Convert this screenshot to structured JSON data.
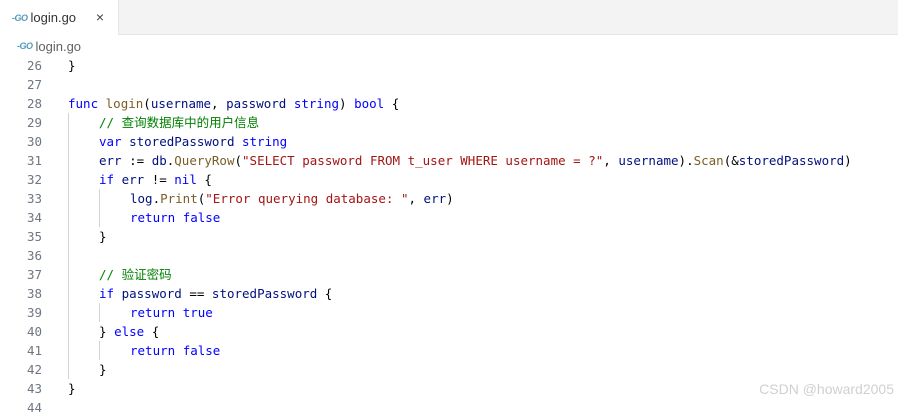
{
  "tab": {
    "filename": "login.go",
    "icon": "go-file-icon",
    "close_glyph": "×"
  },
  "breadcrumb": {
    "filename": "login.go"
  },
  "editor": {
    "lines": [
      {
        "num": "26",
        "indent": 0,
        "tokens": [
          [
            "p",
            "}"
          ]
        ]
      },
      {
        "num": "27",
        "indent": 0,
        "tokens": []
      },
      {
        "num": "28",
        "indent": 0,
        "tokens": [
          [
            "kw",
            "func"
          ],
          [
            "p",
            " "
          ],
          [
            "fn",
            "login"
          ],
          [
            "p",
            "("
          ],
          [
            "vr",
            "username"
          ],
          [
            "p",
            ", "
          ],
          [
            "vr",
            "password"
          ],
          [
            "p",
            " "
          ],
          [
            "kw",
            "string"
          ],
          [
            "p",
            ") "
          ],
          [
            "kw",
            "bool"
          ],
          [
            "p",
            " {"
          ]
        ]
      },
      {
        "num": "29",
        "indent": 1,
        "tokens": [
          [
            "cm",
            "// 查询数据库中的用户信息"
          ]
        ]
      },
      {
        "num": "30",
        "indent": 1,
        "tokens": [
          [
            "kw",
            "var"
          ],
          [
            "p",
            " "
          ],
          [
            "vr",
            "storedPassword"
          ],
          [
            "p",
            " "
          ],
          [
            "kw",
            "string"
          ]
        ]
      },
      {
        "num": "31",
        "indent": 1,
        "tokens": [
          [
            "vr",
            "err"
          ],
          [
            "p",
            " := "
          ],
          [
            "vr",
            "db"
          ],
          [
            "p",
            "."
          ],
          [
            "fn",
            "QueryRow"
          ],
          [
            "p",
            "("
          ],
          [
            "str",
            "\"SELECT password FROM t_user WHERE username = ?\""
          ],
          [
            "p",
            ", "
          ],
          [
            "vr",
            "username"
          ],
          [
            "p",
            ")."
          ],
          [
            "fn",
            "Scan"
          ],
          [
            "p",
            "(&"
          ],
          [
            "vr",
            "storedPassword"
          ],
          [
            "p",
            ")"
          ]
        ]
      },
      {
        "num": "32",
        "indent": 1,
        "tokens": [
          [
            "kw",
            "if"
          ],
          [
            "p",
            " "
          ],
          [
            "vr",
            "err"
          ],
          [
            "p",
            " != "
          ],
          [
            "kw",
            "nil"
          ],
          [
            "p",
            " {"
          ]
        ]
      },
      {
        "num": "33",
        "indent": 2,
        "tokens": [
          [
            "vr",
            "log"
          ],
          [
            "p",
            "."
          ],
          [
            "fn",
            "Print"
          ],
          [
            "p",
            "("
          ],
          [
            "str",
            "\"Error querying database: \""
          ],
          [
            "p",
            ", "
          ],
          [
            "vr",
            "err"
          ],
          [
            "p",
            ")"
          ]
        ]
      },
      {
        "num": "34",
        "indent": 2,
        "tokens": [
          [
            "kw",
            "return"
          ],
          [
            "p",
            " "
          ],
          [
            "kw",
            "false"
          ]
        ]
      },
      {
        "num": "35",
        "indent": 1,
        "tokens": [
          [
            "p",
            "}"
          ]
        ]
      },
      {
        "num": "36",
        "indent": 0,
        "tokens": []
      },
      {
        "num": "37",
        "indent": 1,
        "tokens": [
          [
            "cm",
            "// 验证密码"
          ]
        ]
      },
      {
        "num": "38",
        "indent": 1,
        "tokens": [
          [
            "kw",
            "if"
          ],
          [
            "p",
            " "
          ],
          [
            "vr",
            "password"
          ],
          [
            "p",
            " == "
          ],
          [
            "vr",
            "storedPassword"
          ],
          [
            "p",
            " {"
          ]
        ]
      },
      {
        "num": "39",
        "indent": 2,
        "tokens": [
          [
            "kw",
            "return"
          ],
          [
            "p",
            " "
          ],
          [
            "kw",
            "true"
          ]
        ]
      },
      {
        "num": "40",
        "indent": 1,
        "tokens": [
          [
            "p",
            "} "
          ],
          [
            "kw",
            "else"
          ],
          [
            "p",
            " {"
          ]
        ]
      },
      {
        "num": "41",
        "indent": 2,
        "tokens": [
          [
            "kw",
            "return"
          ],
          [
            "p",
            " "
          ],
          [
            "kw",
            "false"
          ]
        ]
      },
      {
        "num": "42",
        "indent": 1,
        "tokens": [
          [
            "p",
            "}"
          ]
        ]
      },
      {
        "num": "43",
        "indent": 0,
        "tokens": [
          [
            "p",
            "}"
          ]
        ]
      },
      {
        "num": "44",
        "indent": 0,
        "tokens": []
      }
    ]
  },
  "watermark": "CSDN @howard2005",
  "colors": {
    "keyword": "#0000ff",
    "function": "#795e26",
    "string": "#a31515",
    "comment": "#008000",
    "variable": "#001080",
    "line_number": "#6e7681"
  }
}
